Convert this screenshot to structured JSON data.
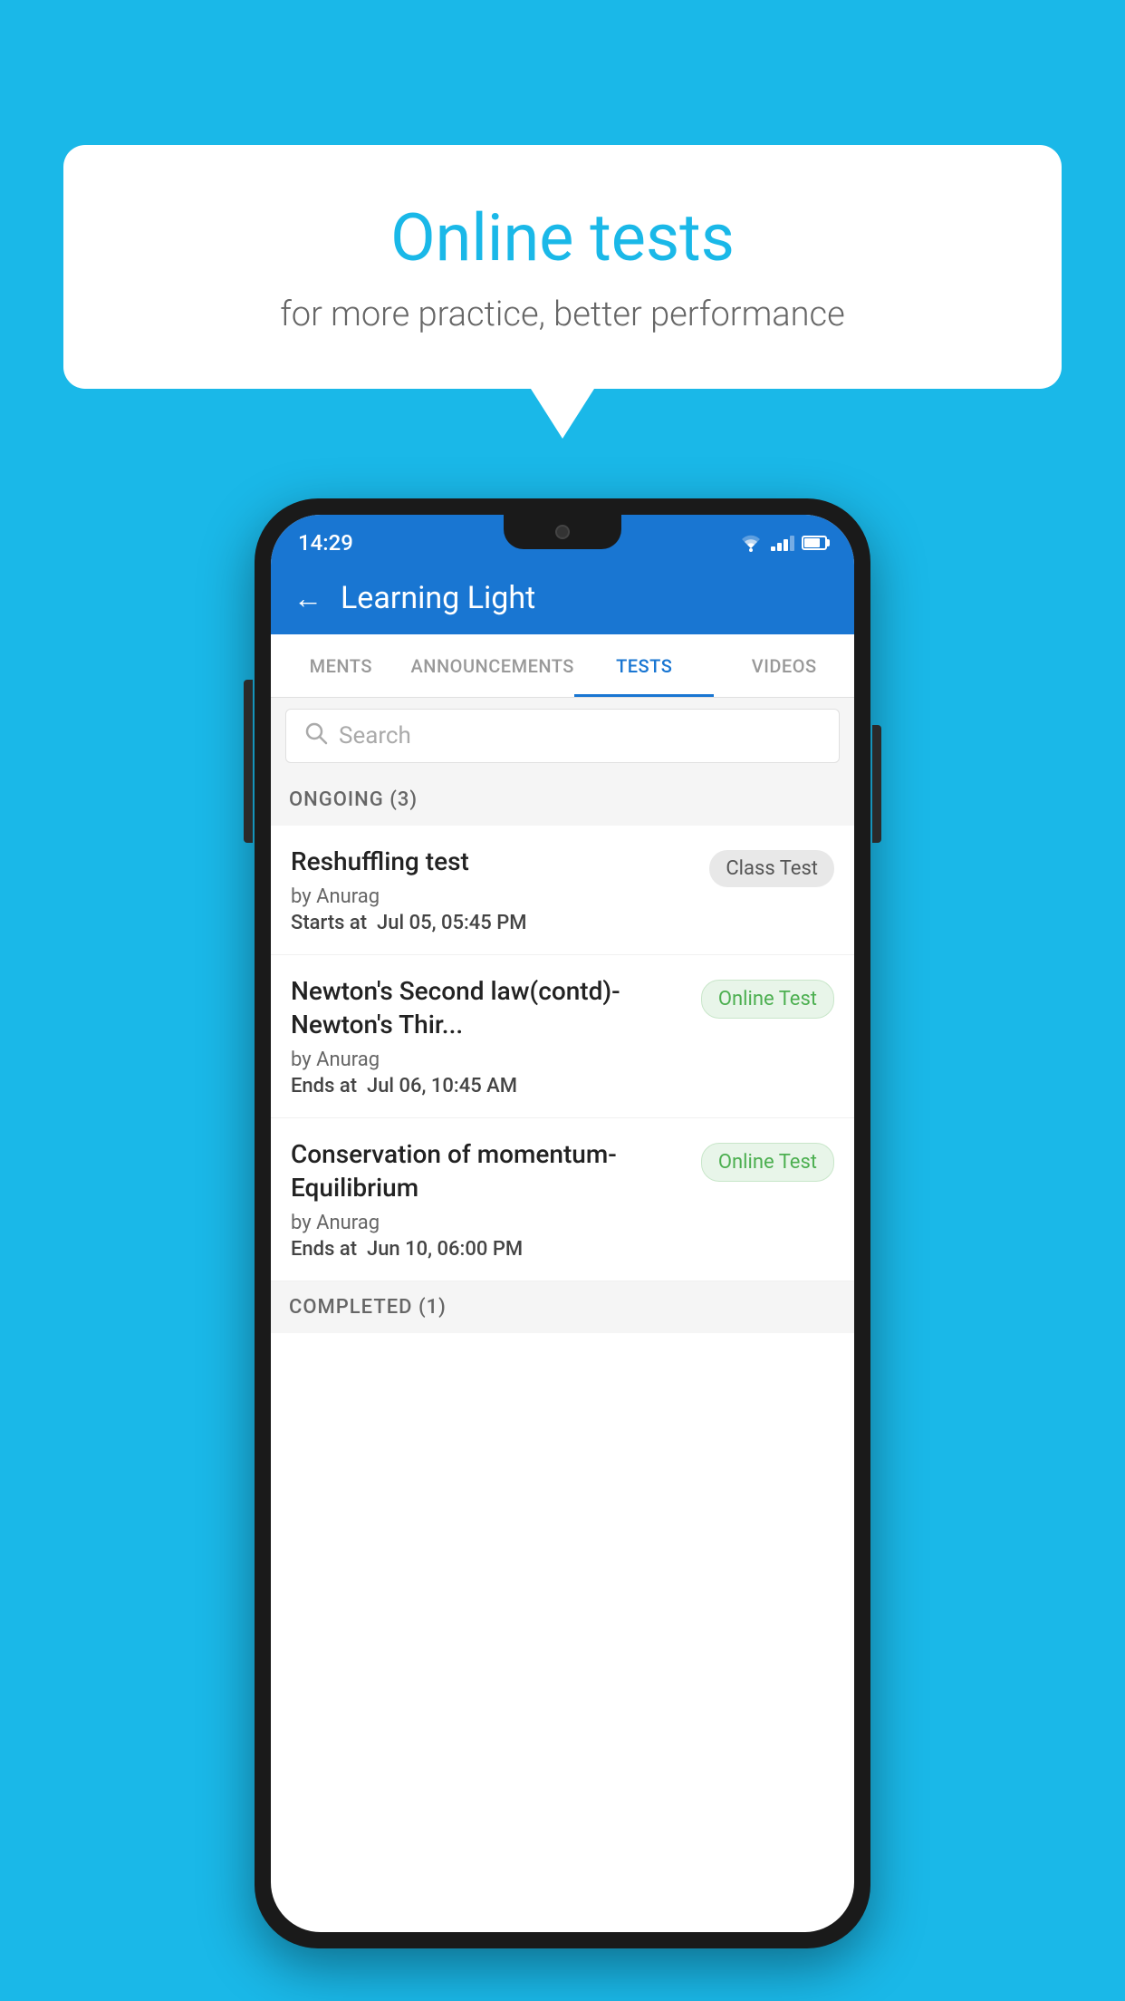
{
  "background_color": "#1AB8E8",
  "speech_bubble": {
    "title": "Online tests",
    "subtitle": "for more practice, better performance"
  },
  "phone": {
    "status_bar": {
      "time": "14:29",
      "icons": [
        "wifi",
        "signal",
        "battery"
      ]
    },
    "app_bar": {
      "back_label": "←",
      "title": "Learning Light"
    },
    "tabs": [
      {
        "label": "MENTS",
        "active": false
      },
      {
        "label": "ANNOUNCEMENTS",
        "active": false
      },
      {
        "label": "TESTS",
        "active": true
      },
      {
        "label": "VIDEOS",
        "active": false
      }
    ],
    "search": {
      "placeholder": "Search",
      "icon": "🔍"
    },
    "sections": [
      {
        "title": "ONGOING (3)",
        "tests": [
          {
            "name": "Reshuffling test",
            "author": "by Anurag",
            "time_label": "Starts at",
            "time_value": "Jul 05, 05:45 PM",
            "badge": "Class Test",
            "badge_type": "class"
          },
          {
            "name": "Newton's Second law(contd)-Newton's Thir...",
            "author": "by Anurag",
            "time_label": "Ends at",
            "time_value": "Jul 06, 10:45 AM",
            "badge": "Online Test",
            "badge_type": "online"
          },
          {
            "name": "Conservation of momentum-Equilibrium",
            "author": "by Anurag",
            "time_label": "Ends at",
            "time_value": "Jun 10, 06:00 PM",
            "badge": "Online Test",
            "badge_type": "online"
          }
        ]
      }
    ],
    "completed_section_title": "COMPLETED (1)"
  }
}
